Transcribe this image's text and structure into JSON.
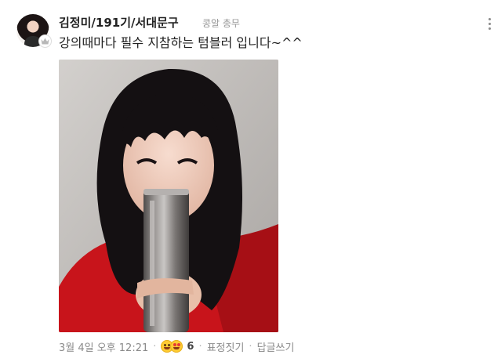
{
  "comment": {
    "author": "김정미/191기/서대문구",
    "role": "콩알 총무",
    "text": "강의때마다 필수 지참하는 텀블러 입니다~^^",
    "photo_alt": "",
    "timestamp": "3월 4일 오후 12:21",
    "reaction_count": "6",
    "react_label": "표정짓기",
    "reply_label": "답글쓰기",
    "separator": "·",
    "icons": [
      "avatar",
      "crown-icon",
      "more-options-icon",
      "reaction-smile-icon",
      "reaction-love-icon"
    ]
  },
  "colors": {
    "text": "#222222",
    "meta": "#8a8a8a",
    "role": "#979797",
    "sweater": "#c8141b",
    "hair": "#141012",
    "bottle": "#8e8a88"
  }
}
